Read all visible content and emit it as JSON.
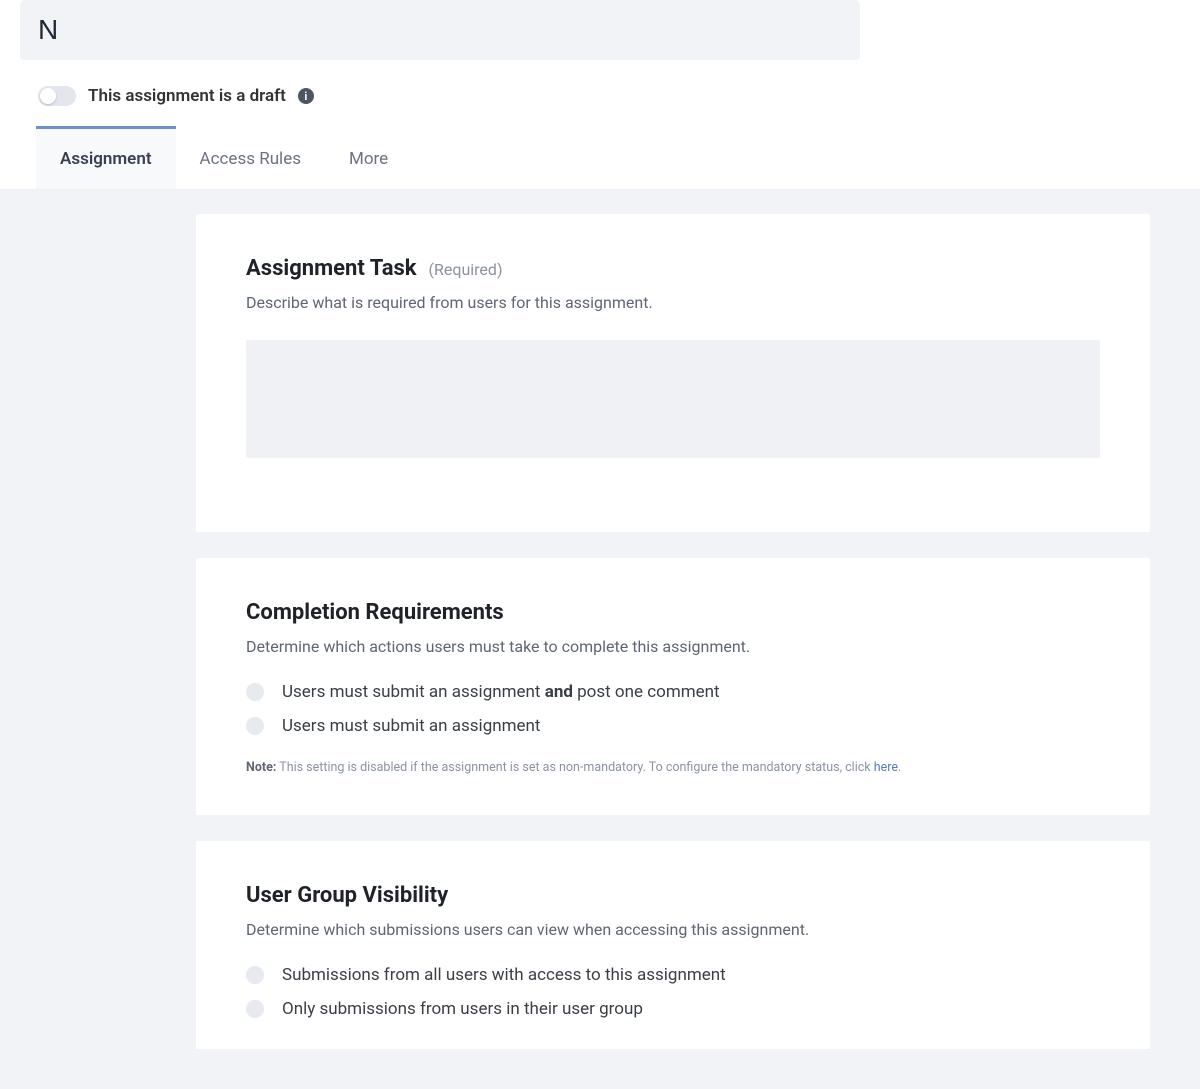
{
  "header": {
    "title_value": "N",
    "draft_label": "This assignment is a draft"
  },
  "tabs": [
    {
      "label": "Assignment",
      "active": true
    },
    {
      "label": "Access Rules",
      "active": false
    },
    {
      "label": "More",
      "active": false
    }
  ],
  "sections": {
    "assignment_task": {
      "title": "Assignment Task",
      "required_tag": "(Required)",
      "desc": "Describe what is required from users for this assignment.",
      "value": ""
    },
    "completion": {
      "title": "Completion Requirements",
      "desc": "Determine which actions users must take to complete this assignment.",
      "options": {
        "opt1_pre": "Users must submit an assignment ",
        "opt1_bold": "and",
        "opt1_post": " post one comment",
        "opt2": "Users must submit an assignment"
      },
      "note_label": "Note:",
      "note_text": " This setting is disabled if the assignment is set as non-mandatory. To configure the mandatory status, click ",
      "note_link": "here",
      "note_tail": "."
    },
    "visibility": {
      "title": "User Group Visibility",
      "desc": "Determine which submissions users can view when accessing this assignment.",
      "options": {
        "opt1": "Submissions from all users with access to this assignment",
        "opt2": "Only submissions from users in their user group"
      }
    }
  }
}
